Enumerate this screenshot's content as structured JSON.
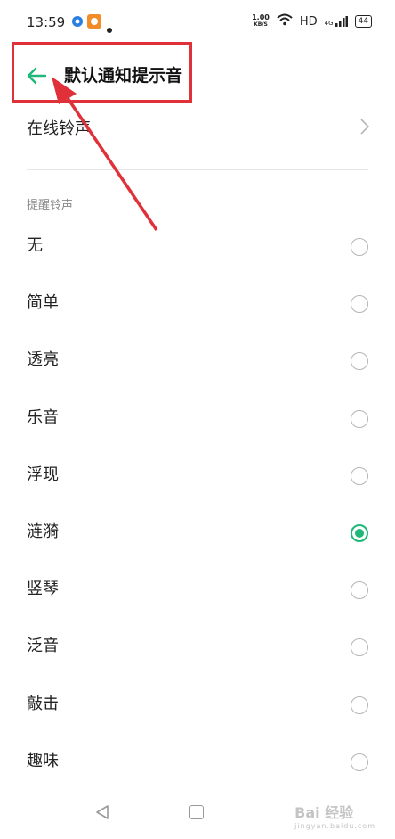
{
  "status_bar": {
    "time": "13:59",
    "net_speed_value": "1.00",
    "net_speed_unit": "KB/S",
    "hd": "HD",
    "signal_label": "4G",
    "battery": "44"
  },
  "header": {
    "back_icon": "arrow-left",
    "title": "默认通知提示音"
  },
  "online_ringtone": {
    "label": "在线铃声",
    "chevron_icon": "chevron-right"
  },
  "section_label": "提醒铃声",
  "ringtones": [
    {
      "label": "无",
      "selected": false
    },
    {
      "label": "简单",
      "selected": false
    },
    {
      "label": "透亮",
      "selected": false
    },
    {
      "label": "乐音",
      "selected": false
    },
    {
      "label": "浮现",
      "selected": false
    },
    {
      "label": "涟漪",
      "selected": true
    },
    {
      "label": "竖琴",
      "selected": false
    },
    {
      "label": "泛音",
      "selected": false
    },
    {
      "label": "敲击",
      "selected": false
    },
    {
      "label": "趣味",
      "selected": false
    }
  ],
  "watermark": {
    "brand": "Bai 经验",
    "url": "jingyan.baidu.com"
  },
  "colors": {
    "accent": "#1fb879",
    "annotation": "#e0303a"
  }
}
